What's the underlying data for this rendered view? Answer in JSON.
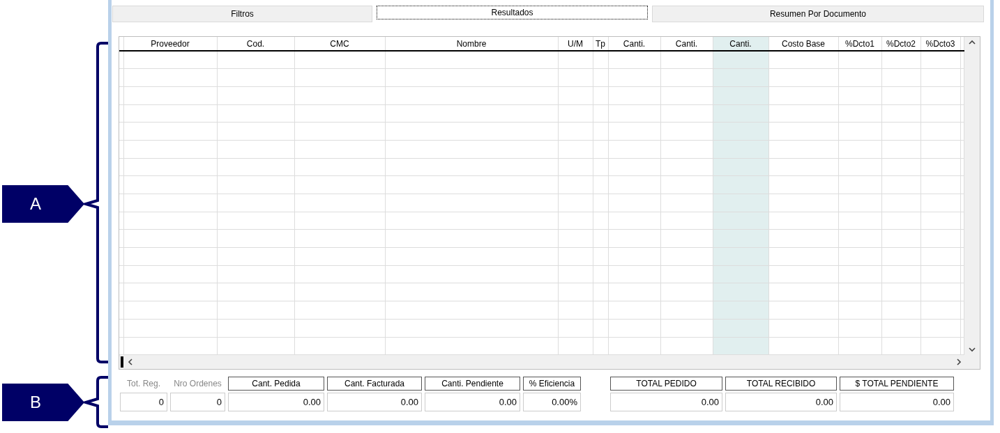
{
  "annotations": [
    {
      "label": "A"
    },
    {
      "label": "B"
    }
  ],
  "tabs": [
    {
      "label": "Filtros",
      "selected": false
    },
    {
      "label": "Resultados",
      "selected": true
    },
    {
      "label": "Resumen Por Documento",
      "selected": false
    }
  ],
  "grid": {
    "columns": [
      {
        "highlighted": false
      },
      {
        "label": "Proveedor",
        "highlighted": false
      },
      {
        "label": "Cod.",
        "highlighted": false
      },
      {
        "label": "CMC",
        "highlighted": false
      },
      {
        "label": "Nombre",
        "highlighted": false
      },
      {
        "label": "U/M",
        "highlighted": false
      },
      {
        "label": "Tp",
        "highlighted": false
      },
      {
        "label": "Canti.",
        "highlighted": false
      },
      {
        "label": "Canti.",
        "highlighted": false
      },
      {
        "label": "Canti.",
        "highlighted": true
      },
      {
        "label": "Costo Base",
        "highlighted": false
      },
      {
        "label": "%Dcto1",
        "highlighted": false
      },
      {
        "label": "%Dcto2",
        "highlighted": false
      },
      {
        "label": "%Dcto3",
        "highlighted": false
      },
      {
        "highlighted": false
      }
    ]
  },
  "summary": [
    {
      "kind": "plain",
      "label": "Tot. Reg.",
      "value": "0"
    },
    {
      "kind": "plain",
      "label": "Nro Ordenes",
      "value": "0"
    },
    {
      "kind": "boxed",
      "label": "Cant. Pedida",
      "value": "0.00"
    },
    {
      "kind": "boxed",
      "label": "Cant. Facturada",
      "value": "0.00"
    },
    {
      "kind": "boxed",
      "label": "Canti. Pendiente",
      "value": "0.00"
    },
    {
      "kind": "boxed",
      "label": "% Eficiencia",
      "value": "0.00%"
    },
    {
      "kind": "gap"
    },
    {
      "kind": "boxed",
      "label": "TOTAL PEDIDO",
      "value": "0.00"
    },
    {
      "kind": "boxed",
      "label": "TOTAL RECIBIDO",
      "value": "0.00"
    },
    {
      "kind": "boxed",
      "label": "$ TOTAL PENDIENTE",
      "value": "0.00"
    }
  ]
}
